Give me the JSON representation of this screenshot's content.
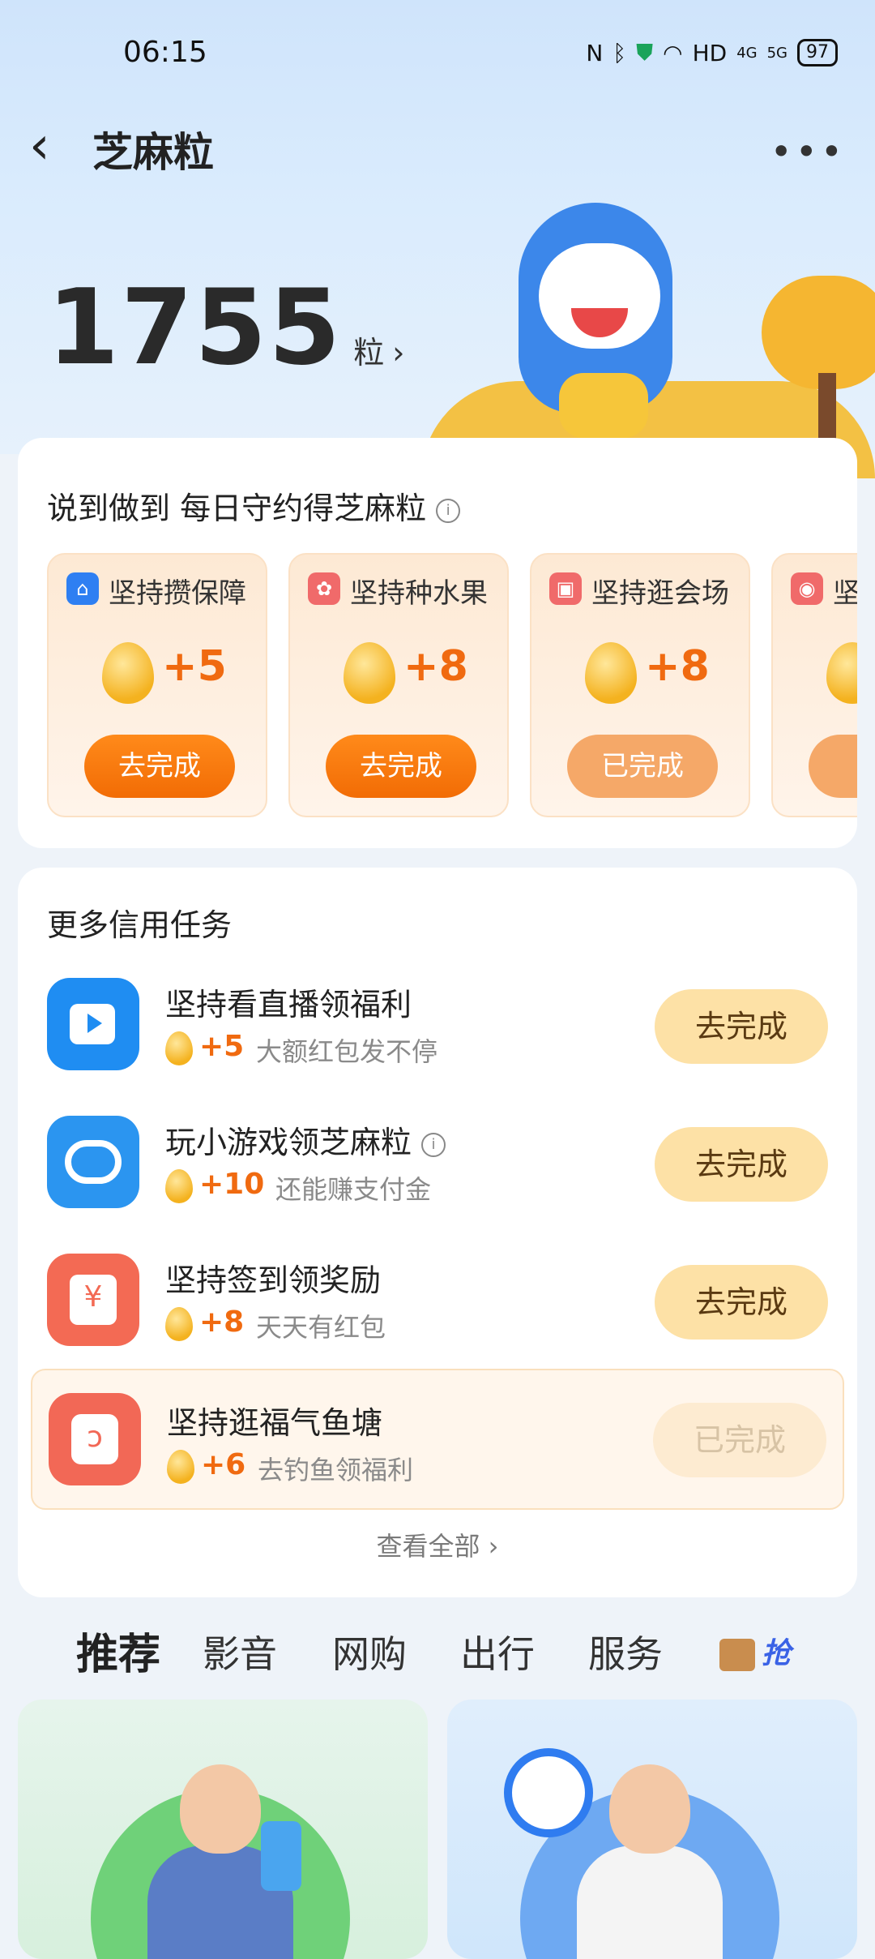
{
  "status_bar": {
    "time": "06:15",
    "icons": [
      "nfc-icon",
      "bluetooth-icon",
      "shield-icon",
      "wifi-icon",
      "HD",
      "4G",
      "5G"
    ],
    "battery": "97"
  },
  "nav": {
    "title": "芝麻粒",
    "back_glyph": "‹",
    "more_glyph": "•••"
  },
  "points": {
    "value": "1755",
    "unit": "粒",
    "chevron": "›"
  },
  "daily": {
    "title": "说到做到 每日守约得芝麻粒",
    "tasks": [
      {
        "title": "坚持攒保障",
        "points": "+5",
        "button": "去完成",
        "state": "todo",
        "icon": "shield-house-icon",
        "icon_color": "#2e7ff2"
      },
      {
        "title": "坚持种水果",
        "points": "+8",
        "button": "去完成",
        "state": "todo",
        "icon": "fruit-tree-icon",
        "icon_color": "#f06a6a"
      },
      {
        "title": "坚持逛会场",
        "points": "+8",
        "button": "已完成",
        "state": "done",
        "icon": "gift-icon",
        "icon_color": "#f06a6a"
      },
      {
        "title": "坚",
        "points": "",
        "button": "已",
        "state": "done",
        "icon": "pet-icon",
        "icon_color": "#f06a6a"
      }
    ]
  },
  "more": {
    "title": "更多信用任务",
    "tasks": [
      {
        "name": "坚持看直播领福利",
        "points": "+5",
        "desc": "大额红包发不停",
        "button": "去完成",
        "state": "todo",
        "icon": "play-icon",
        "icon_color": "#1f8df2"
      },
      {
        "name": "玩小游戏领芝麻粒",
        "points": "+10",
        "desc": "还能赚支付金",
        "button": "去完成",
        "state": "todo",
        "icon": "gamepad-icon",
        "icon_color": "#2b95f0"
      },
      {
        "name": "坚持签到领奖励",
        "points": "+8",
        "desc": "天天有红包",
        "button": "去完成",
        "state": "todo",
        "icon": "yen-wallet-icon",
        "icon_color": "#f36a54"
      },
      {
        "name": "坚持逛福气鱼塘",
        "points": "+6",
        "desc": "去钓鱼领福利",
        "button": "已完成",
        "state": "done",
        "icon": "fishhook-icon",
        "icon_color": "#f26856"
      }
    ],
    "view_all": "查看全部 ›"
  },
  "tabs": {
    "items": [
      "推荐",
      "影音",
      "网购",
      "出行",
      "服务"
    ],
    "active": "推荐",
    "extra": "抢"
  },
  "colors": {
    "accent_orange": "#f26c05",
    "points_orange": "#f06a10",
    "button_cream": "#fde1a6"
  }
}
